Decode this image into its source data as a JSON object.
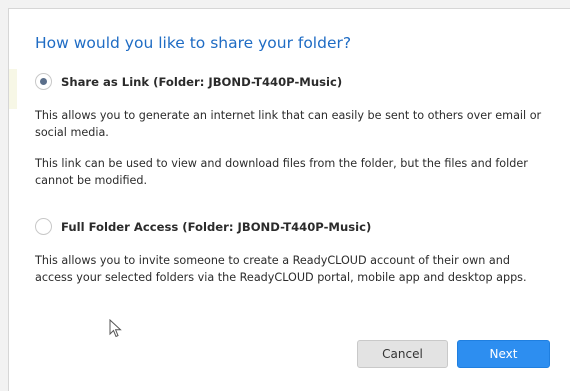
{
  "dialog": {
    "title": "How would you like to share your folder?",
    "options": [
      {
        "label": "Share as Link (Folder: JBOND-T440P-Music)",
        "selected": true
      },
      {
        "label": "Full Folder Access (Folder: JBOND-T440P-Music)",
        "selected": false
      }
    ],
    "link_desc_1": "This allows you to generate an internet link that can easily be sent to others over email or social media.",
    "link_desc_2": "This link can be used to view and download files from the folder, but the files and folder cannot be modified.",
    "access_desc": "This allows you to invite someone to create a ReadyCLOUD account of their own and access your selected folders via the ReadyCLOUD portal, mobile app and desktop apps.",
    "buttons": {
      "cancel": "Cancel",
      "next": "Next"
    }
  },
  "colors": {
    "title": "#1f6cc4",
    "primary_button": "#2d8ef0",
    "secondary_button": "#e3e3e3"
  }
}
